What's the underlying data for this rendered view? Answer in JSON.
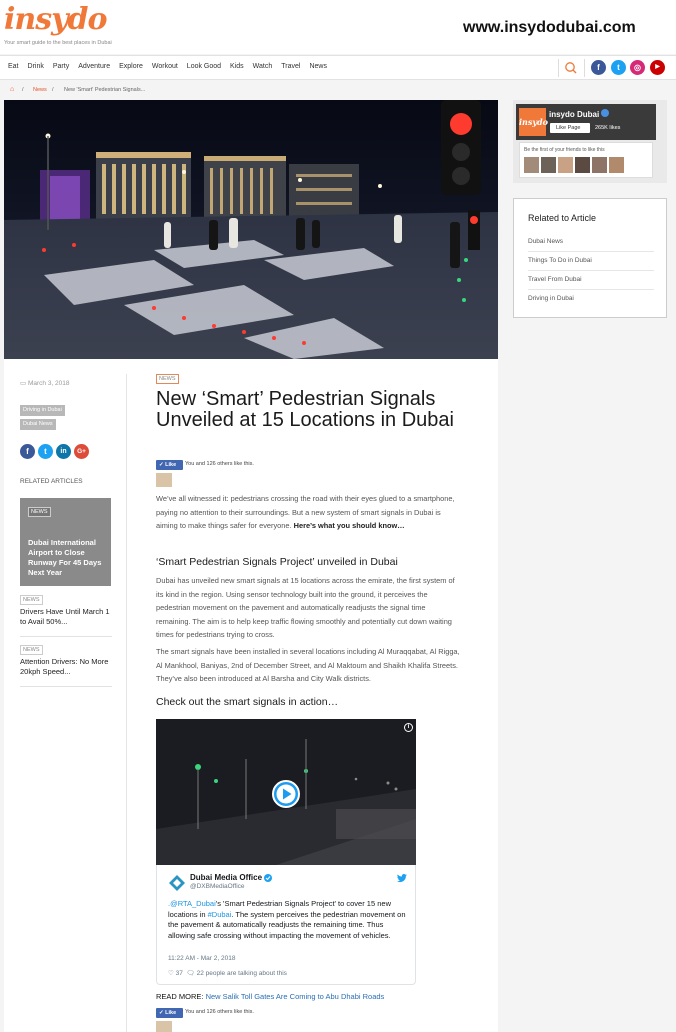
{
  "header": {
    "logo": "insydo",
    "tagline": "Your smart guide to the best places in Dubai",
    "site_url": "www.insydodubai.com"
  },
  "nav": {
    "items": [
      "Eat",
      "Drink",
      "Party",
      "Adventure",
      "Explore",
      "Workout",
      "Look Good",
      "Kids",
      "Watch",
      "Travel",
      "News"
    ],
    "social": [
      {
        "name": "facebook",
        "glyph": "f",
        "color": "#3b5998"
      },
      {
        "name": "twitter",
        "glyph": "t",
        "color": "#1da1f2"
      },
      {
        "name": "instagram",
        "glyph": "◎",
        "color": "#d62976"
      },
      {
        "name": "youtube",
        "glyph": "▶",
        "color": "#cc0000"
      }
    ]
  },
  "breadcrumb": {
    "home_icon": "home-icon",
    "sep": "/",
    "section": "News",
    "current": "New 'Smart' Pedestrian Signals..."
  },
  "article": {
    "date": "March 3, 2018",
    "tags": [
      "Driving in Dubai",
      "Dubai News"
    ],
    "category": "NEWS",
    "title": "New ‘Smart’ Pedestrian Signals Unveiled at 15 Locations in Dubai",
    "like_label": "Like",
    "like_text": "You and 126 others like this.",
    "intro_plain": "We’ve all witnessed it: pedestrians crossing the road with their eyes glued to a smartphone, paying no attention to their surroundings. But a new system of smart signals in Dubai is aiming to make things safer for everyone. ",
    "intro_bold": "Here’s what you should know…",
    "heading1": "‘Smart Pedestrian Signals Project’ unveiled in Dubai",
    "para1": "Dubai has unveiled new smart signals at 15 locations across the emirate, the first system of its kind in the region. Using sensor technology built into the ground, it perceives the pedestrian movement on the pavement and automatically readjusts the signal time remaining. The aim is to help keep traffic flowing smoothly and potentially cut down waiting times for pedestrians trying to cross.",
    "para2": "The smart signals have been installed in several locations including Al Muraqqabat, Al Rigga, Al Mankhool, Baniyas, 2nd of December Street, and Al Maktoum and Shaikh Khalifa Streets. They’ve also been introduced at Al Barsha and City Walk districts.",
    "heading2": "Check out the smart signals in action…",
    "read_more_label": "READ MORE: ",
    "read_more_link": "New Salik Toll Gates Are Coming to Abu Dhabi Roads",
    "like_text2": "You and 126 others like this."
  },
  "share": [
    {
      "name": "facebook",
      "glyph": "f",
      "color": "#3b5998"
    },
    {
      "name": "twitter",
      "glyph": "t",
      "color": "#1da1f2"
    },
    {
      "name": "linkedin",
      "glyph": "in",
      "color": "#0e76a8"
    },
    {
      "name": "google-plus",
      "glyph": "G+",
      "color": "#dd4b39"
    }
  ],
  "related_left": {
    "heading": "RELATED ARTICLES",
    "card_badge": "NEWS",
    "card_title": "Dubai International Airport to Close Runway For 45 Days Next Year",
    "items": [
      {
        "badge": "NEWS",
        "title": "Drivers Have Until March 1 to Avail 50%..."
      },
      {
        "badge": "NEWS",
        "title": "Attention Drivers: No More 20kph Speed..."
      }
    ]
  },
  "tweet": {
    "name": "Dubai Media Office",
    "handle": "@DXBMediaOffice",
    "mention": ".@RTA_Dubai",
    "text_a": "'s 'Smart Pedestrian Signals Project' to cover 15 new locations in ",
    "hashtag": "#Dubai",
    "text_b": ". The system perceives the pedestrian movement on the pavement & automatically readjusts the remaining time. Thus allowing safe crossing without impacting the movement of vehicles.",
    "time": "11:22 AM - Mar 2, 2018",
    "likes": "37",
    "talk": "22 people are talking about this",
    "info_glyph": "i"
  },
  "sidebar": {
    "fb_page": "insydo Dubai",
    "fb_logo": "insydo",
    "fb_like": "Like Page",
    "fb_likes": "265K likes",
    "fb_friends_text": "Be the first of your friends to like this",
    "related_heading": "Related to Article",
    "related_items": [
      "Dubai News",
      "Things To Do in Dubai",
      "Travel From Dubai",
      "Driving in Dubai"
    ]
  }
}
